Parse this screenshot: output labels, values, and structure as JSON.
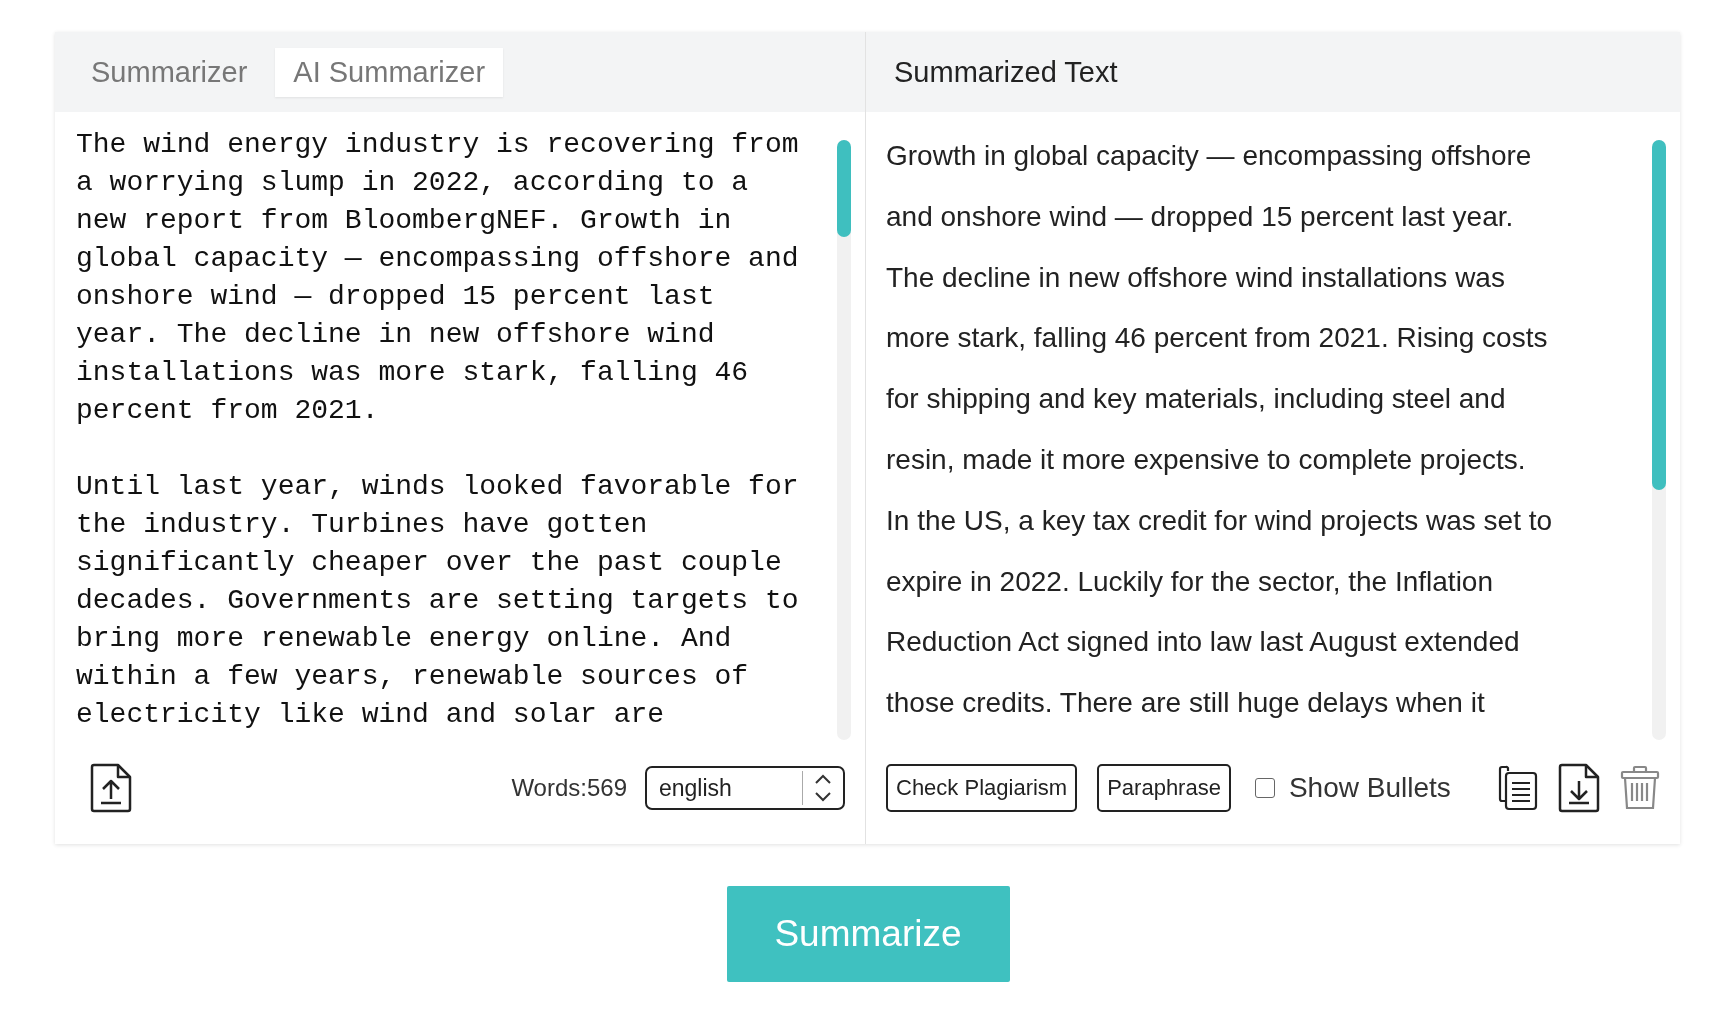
{
  "tabs": [
    {
      "label": "Summarizer",
      "selected": false
    },
    {
      "label": "AI Summarizer",
      "selected": true
    }
  ],
  "output_title": "Summarized Text",
  "input": {
    "paragraphs": [
      [
        "The wind energy industry is recovering from",
        "a worrying slump in 2022, according to a",
        "new report from BloombergNEF. Growth in",
        "global capacity — encompassing offshore and",
        "onshore wind — dropped 15 percent last",
        "year. The decline in new offshore wind",
        "installations was more stark, falling 46",
        "percent from 2021."
      ],
      [
        "Until last year, winds looked favorable for",
        "the industry. Turbines have gotten",
        "significantly cheaper over the past couple",
        "decades. Governments are setting targets to",
        "bring more renewable energy online. And",
        "within a few years, renewable sources of",
        "electricity like wind and solar are"
      ]
    ],
    "word_count": "Words:569",
    "language": "english"
  },
  "output": {
    "lines": [
      "Growth in global capacity — encompassing offshore",
      "and onshore wind — dropped 15 percent last year.",
      "The decline in new offshore wind installations was",
      "more stark, falling 46 percent from 2021. Rising costs",
      "for shipping and key materials, including steel and",
      "resin, made it more expensive to complete projects.",
      "In the US, a key tax credit for wind projects was set to",
      "expire in 2022. Luckily for the sector, the Inflation",
      "Reduction Act signed into law last August extended",
      "those credits. There are still huge delays when it"
    ],
    "buttons": [
      "Check Plagiarism",
      "Paraphrase"
    ],
    "show_bullets": {
      "label": "Show Bullets",
      "checked": false
    }
  },
  "action_button": "Summarize"
}
